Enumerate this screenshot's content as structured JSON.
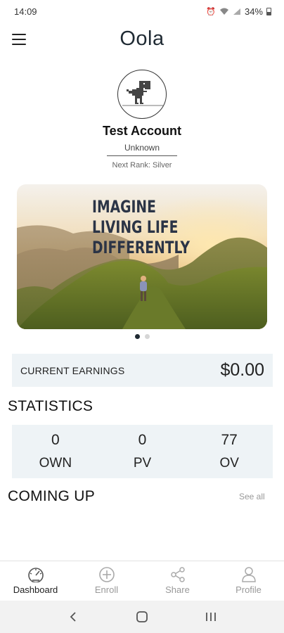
{
  "status_bar": {
    "time": "14:09",
    "battery": "34%"
  },
  "header": {
    "logo": "Oola"
  },
  "profile": {
    "name": "Test Account",
    "rank_status": "Unknown",
    "next_rank": "Next Rank: Silver"
  },
  "banner": {
    "lines": [
      "IMAGINE",
      "LIVING LIFE",
      "DIFFERENTLY"
    ],
    "slide_count": 2,
    "active_slide": 1
  },
  "earnings": {
    "label": "CURRENT EARNINGS",
    "value": "$0.00"
  },
  "statistics": {
    "title": "STATISTICS",
    "items": [
      {
        "value": "0",
        "label": "OWN"
      },
      {
        "value": "0",
        "label": "PV"
      },
      {
        "value": "77",
        "label": "OV"
      }
    ]
  },
  "coming_up": {
    "title": "COMING UP",
    "see_all": "See all"
  },
  "bottom_nav": {
    "items": [
      {
        "label": "Dashboard",
        "icon": "gauge-icon"
      },
      {
        "label": "Enroll",
        "icon": "plus-circle-icon"
      },
      {
        "label": "Share",
        "icon": "share-icon"
      },
      {
        "label": "Profile",
        "icon": "person-icon"
      }
    ],
    "active": "Dashboard"
  },
  "colors": {
    "card_background": "#eef3f6",
    "banner_text": "#2b3446",
    "inactive_label": "#999999"
  }
}
